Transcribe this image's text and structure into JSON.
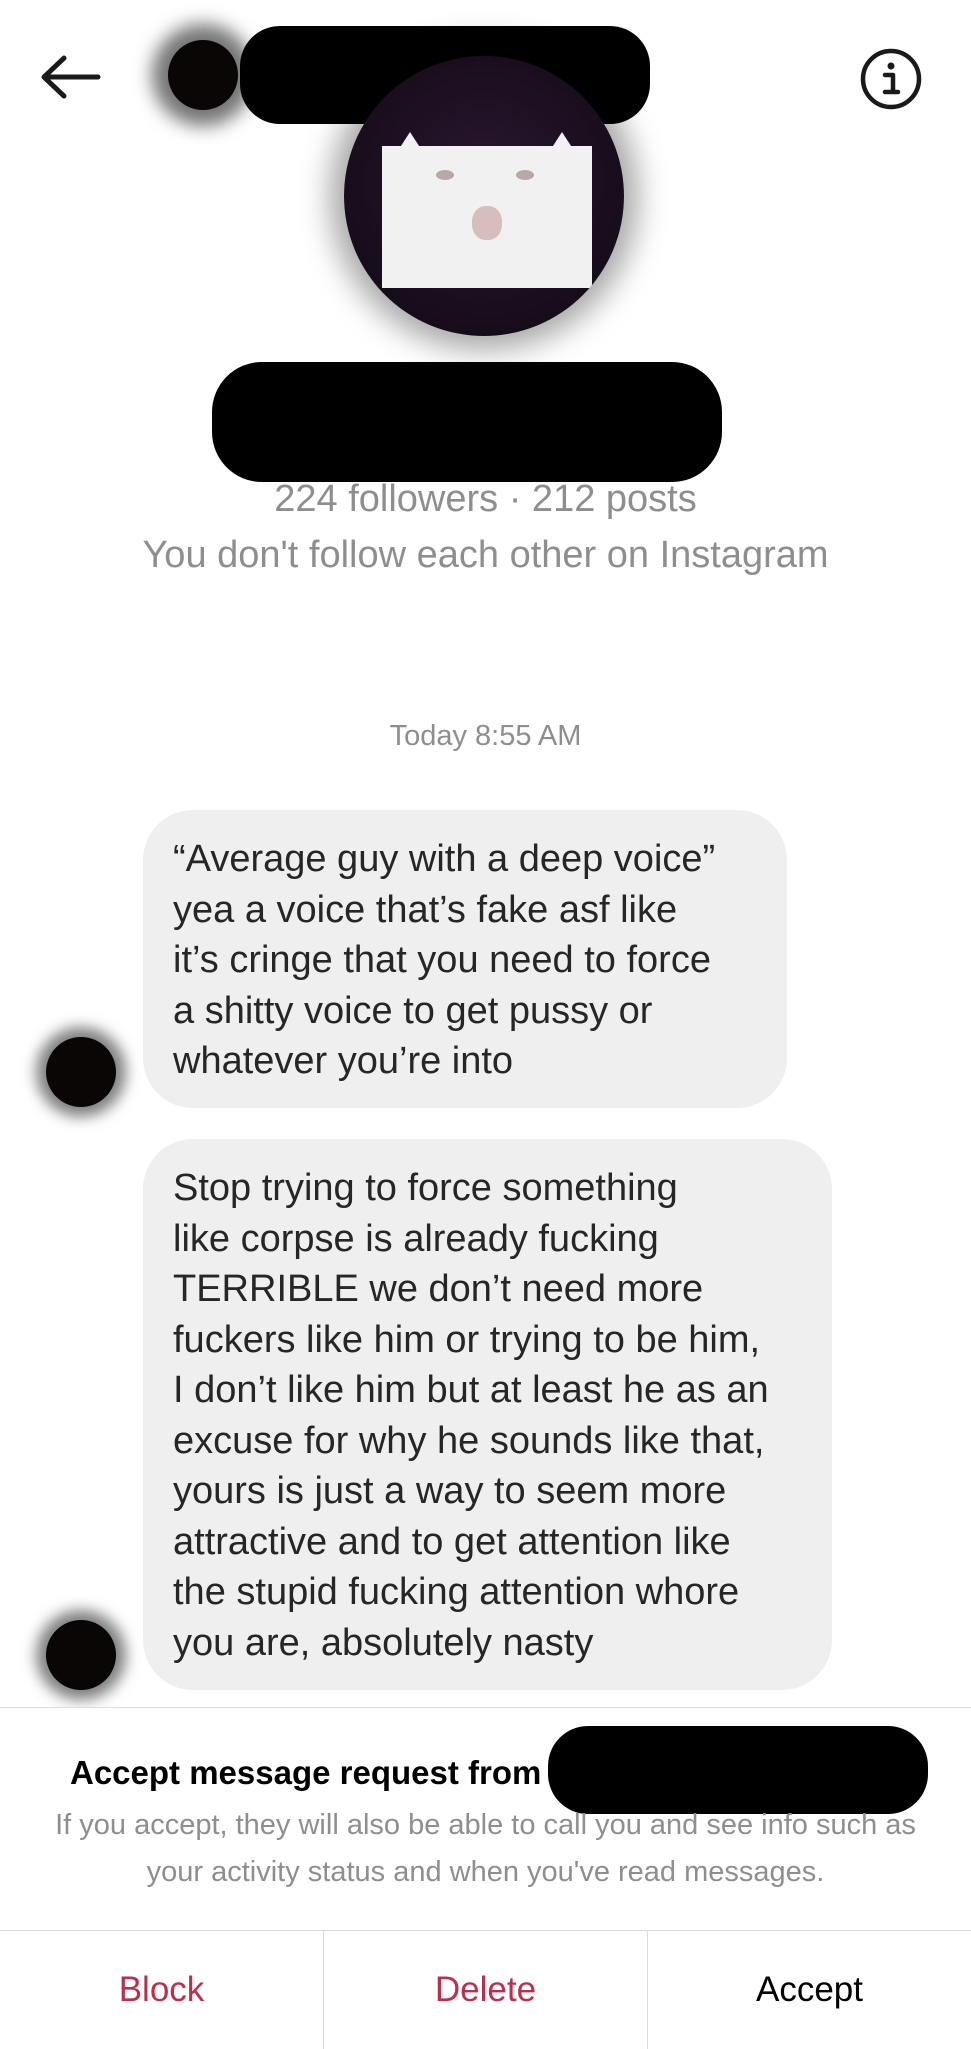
{
  "header": {
    "back_icon": "arrow-left-icon",
    "info_icon": "info-circle-icon"
  },
  "profile": {
    "stats": "224 followers · 212 posts",
    "follow_status": "You don't follow each other on Instagram"
  },
  "thread": {
    "timestamp": "Today 8:55 AM",
    "messages": [
      {
        "lines": [
          "“Average guy with a deep voice”",
          "yea a voice that’s fake asf like",
          "it’s cringe that you need to force",
          "a shitty voice to get pussy or",
          "whatever you’re into"
        ]
      },
      {
        "lines": [
          "Stop trying to force something",
          "like corpse is already fucking",
          "TERRIBLE we don’t need more",
          "fuckers like him or trying to be him,",
          "I don’t like him but at least he as an",
          "excuse for why he sounds like that,",
          "yours is just a way to seem more",
          "attractive and to get attention like",
          "the stupid fucking attention whore",
          "you are, absolutely nasty"
        ]
      }
    ]
  },
  "request": {
    "title": "Accept message request from",
    "description": "If you accept, they will also be able to call you and see info such as your activity status and when you've read messages.",
    "actions": {
      "block": "Block",
      "delete": "Delete",
      "accept": "Accept"
    }
  },
  "colors": {
    "destructive": "#c02d4c",
    "bubble": "#efefef",
    "secondary_text": "#8e8e8e"
  }
}
